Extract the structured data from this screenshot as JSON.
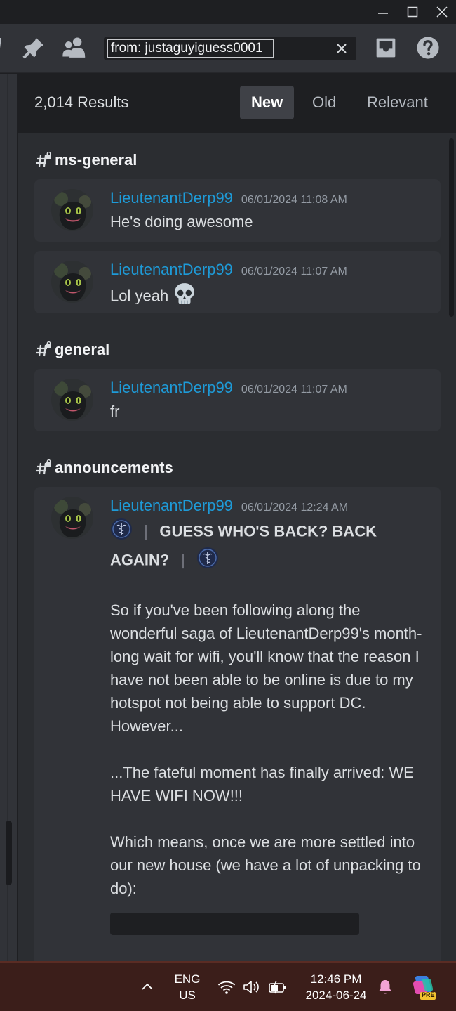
{
  "window": {
    "minimize_icon": "minimize-icon",
    "maximize_icon": "maximize-icon",
    "close_icon": "close-icon"
  },
  "toolbar": {
    "pin_icon": "pin-icon",
    "members_icon": "members-icon",
    "search_value": "from: justaguyiguess0001",
    "clear_icon": "close-icon",
    "inbox_icon": "inbox-icon",
    "help_icon": "help-icon"
  },
  "results": {
    "count": "2,014 Results",
    "tabs": [
      {
        "label": "New",
        "active": true
      },
      {
        "label": "Old",
        "active": false
      },
      {
        "label": "Relevant",
        "active": false
      }
    ]
  },
  "groups": [
    {
      "channel": "ms-general",
      "messages": [
        {
          "author": "LieutenantDerp99",
          "timestamp": "06/01/2024 11:08 AM",
          "text": "He's doing awesome"
        },
        {
          "author": "LieutenantDerp99",
          "timestamp": "06/01/2024 11:07 AM",
          "text": "Lol yeah",
          "emoji": "skull-emoji"
        }
      ]
    },
    {
      "channel": "general",
      "messages": [
        {
          "author": "LieutenantDerp99",
          "timestamp": "06/01/2024 11:07 AM",
          "text": "fr"
        }
      ]
    },
    {
      "channel": "announcements",
      "messages": [
        {
          "author": "LieutenantDerp99",
          "timestamp": "06/01/2024 12:24 AM",
          "heading_a": "GUESS WHO'S BACK? BACK",
          "heading_b": "AGAIN?",
          "separator": "|",
          "paragraphs": [
            "So if you've been following along the wonderful saga of LieutenantDerp99's month-long wait for wifi, you'll know that the reason I have not been able to be online is due to my hotspot not being able to support DC. However...",
            "...The fateful moment has finally arrived: WE HAVE WIFI NOW!!!",
            "Which means, once we are more settled into our new house (we have a lot of unpacking to do):"
          ]
        }
      ]
    }
  ],
  "taskbar": {
    "language_line1": "ENG",
    "language_line2": "US",
    "time": "12:46 PM",
    "date": "2024-06-24",
    "copilot_badge": "PRE"
  },
  "colors": {
    "author": "#1e9bd8",
    "panel": "#2b2d31",
    "card": "#313338",
    "taskbar": "#3b1e1a"
  }
}
